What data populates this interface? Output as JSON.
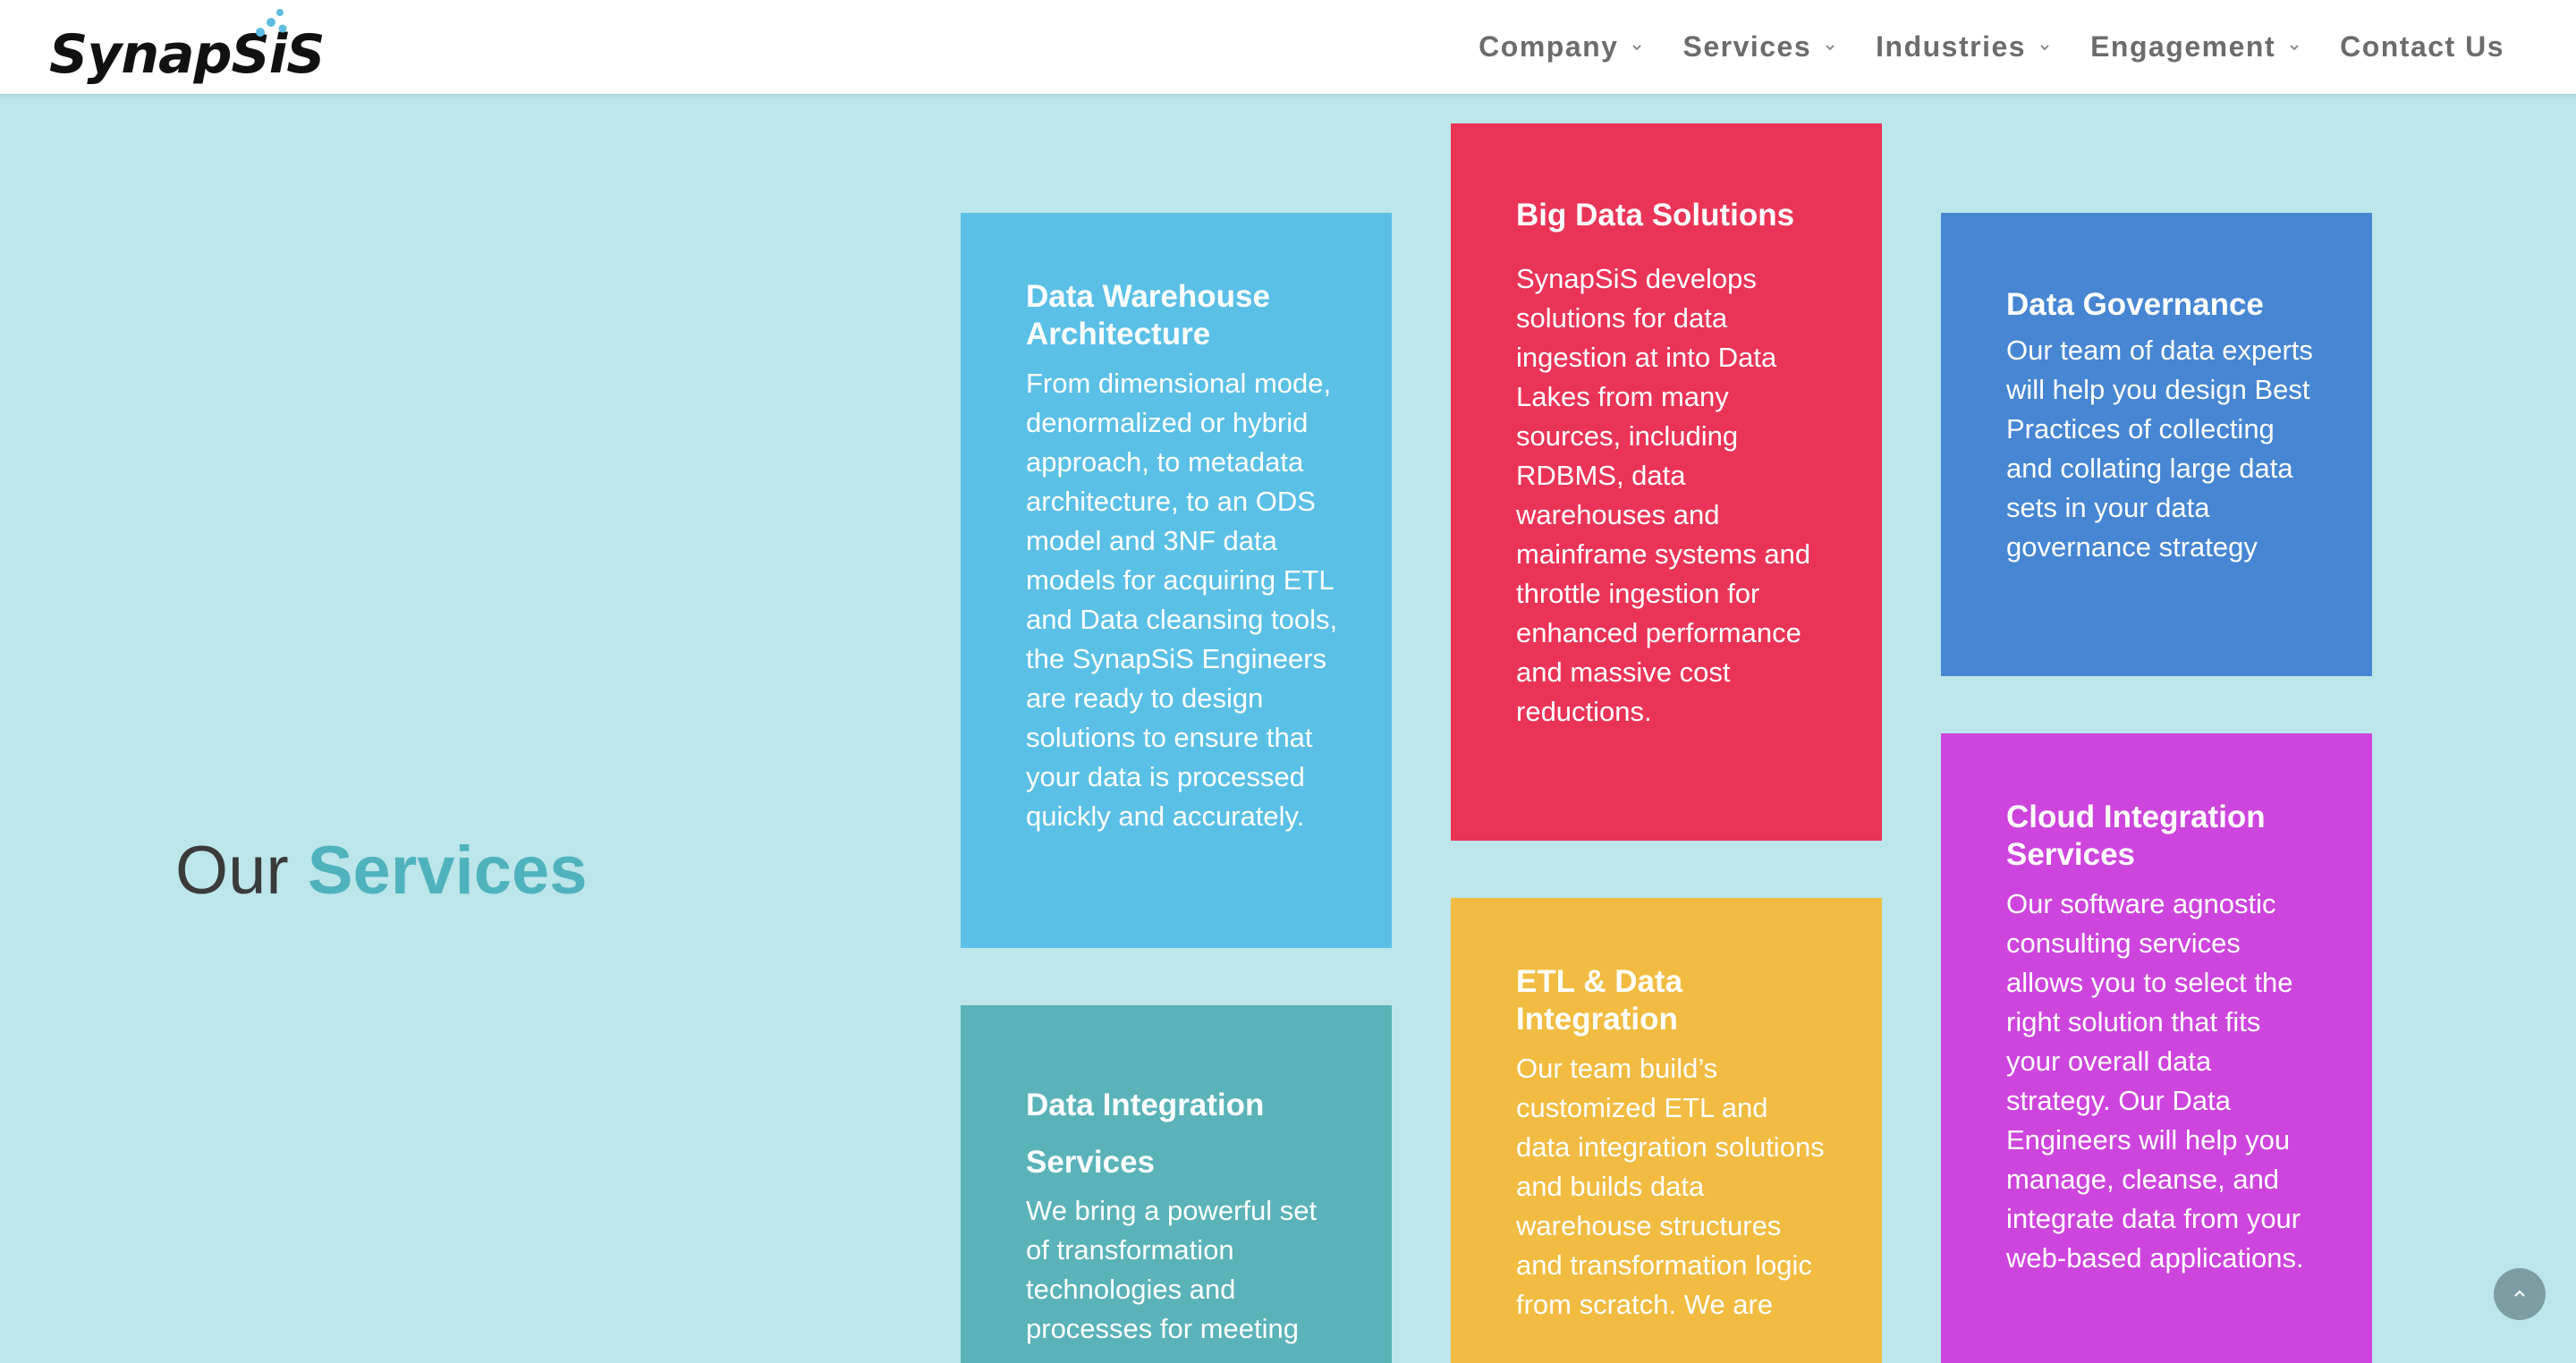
{
  "brand": {
    "logo_text": "SynapSiS",
    "accent_color": "#4fb3bd",
    "logo_dot_color": "#5bbde0"
  },
  "nav": {
    "items": [
      {
        "label": "Company",
        "has_dropdown": true
      },
      {
        "label": "Services",
        "has_dropdown": true
      },
      {
        "label": "Industries",
        "has_dropdown": true
      },
      {
        "label": "Engagement",
        "has_dropdown": true
      },
      {
        "label": "Contact Us",
        "has_dropdown": false
      }
    ]
  },
  "section": {
    "title_prefix": "Our",
    "title_accent": "Services"
  },
  "cards": {
    "data_warehouse": {
      "title": "Data Warehouse Architecture",
      "text": "From dimensional mode, denormalized or hybrid approach, to metadata architecture, to an ODS model and 3NF data models for acquiring ETL and Data cleansing tools, the SynapSiS Engineers are ready to design solutions to ensure that your data is processed quickly and accurately.",
      "color": "#5bc0e6"
    },
    "big_data": {
      "title": "Big Data Solutions",
      "text": "SynapSiS develops solutions for data ingestion at into Data Lakes from many sources, including RDBMS, data warehouses and mainframe systems and throttle ingestion for enhanced performance and massive cost reductions.",
      "color": "#ea3457"
    },
    "data_governance": {
      "title": "Data Governance",
      "text": "Our team of data experts will help you design Best Practices of collecting and collating large data sets in your data governance strategy",
      "color": "#4686d2"
    },
    "data_integration": {
      "title": "Data Integration Services",
      "text": "We bring a powerful set of transformation technologies and processes for meeting",
      "color": "#5ab3b8"
    },
    "etl": {
      "title": "ETL & Data Integration",
      "text": "Our team build’s customized ETL and data integration solutions and builds data warehouse structures and transformation logic from scratch. We are",
      "color": "#f1bc41"
    },
    "cloud_integration": {
      "title": "Cloud Integration Services",
      "text": "Our software agnostic consulting services allows you to select the right solution that fits your overall data strategy. Our Data Engineers will help you manage, cleanse, and integrate data from your web-based applications.",
      "color": "#cd45dd"
    }
  },
  "icons": {
    "back_to_top": "chevron-up-icon",
    "dropdown": "chevron-down-icon"
  }
}
